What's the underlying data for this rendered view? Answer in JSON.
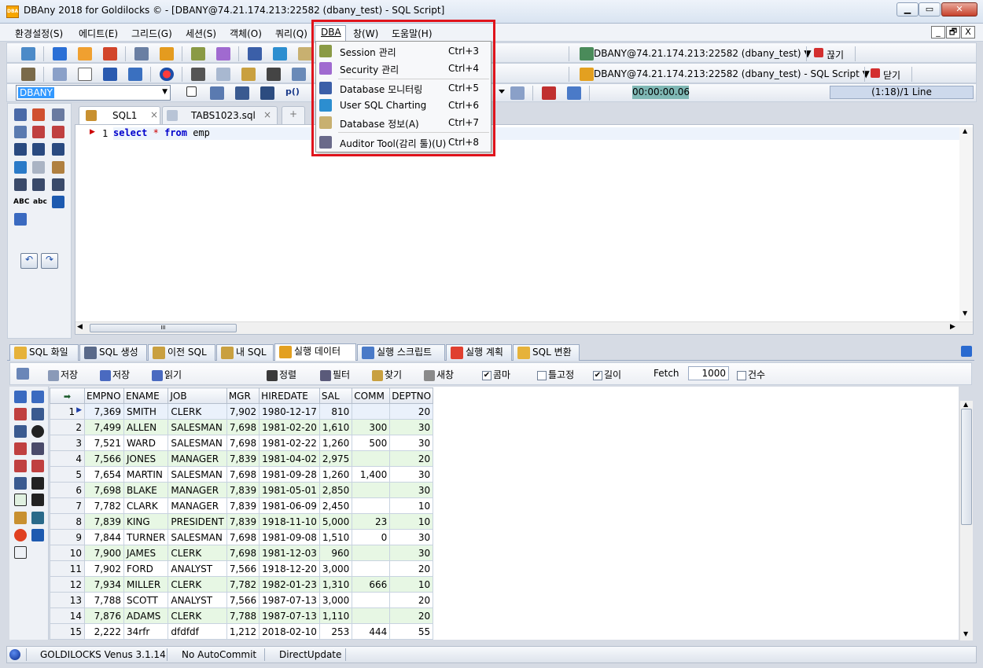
{
  "window": {
    "title": "DBAny 2018 for Goldilocks © - [DBANY@74.21.174.213:22582 (dbany_test) - SQL Script]",
    "logo_text": "DBA",
    "buttons": {
      "minimize": "▭",
      "restore": "▭",
      "close": "✕"
    }
  },
  "menubar": {
    "items": [
      "환경설정(S)",
      "에디트(E)",
      "그리드(G)",
      "세션(S)",
      "객체(O)",
      "쿼리(Q)",
      "DBA",
      "창(W)",
      "도움말(H)"
    ],
    "mdi": [
      "_",
      "🗗",
      "X"
    ]
  },
  "toolbar": {
    "session_label": "DBANY@74.21.174.213:22582 (dbany_test) ▼",
    "disconnect_label": "끊기",
    "script_label": "DBANY@74.21.174.213:22582 (dbany_test) - SQL Script ▼",
    "close_label": "닫기",
    "schema_value": "DBANY",
    "timer": "00:00:00.06",
    "line_info": "(1:18)/1 Line",
    "left_abc_upper": "ABC",
    "left_abc_lower": "abc"
  },
  "editor": {
    "tabs": [
      "SQL1",
      "TABS1023.sql"
    ],
    "line_number": "1",
    "code": {
      "kw1": "select",
      "op": "*",
      "kw2": "from",
      "ident": "emp"
    },
    "hscroll_grip": "III"
  },
  "dba_menu": {
    "items": [
      {
        "label": "Session 관리",
        "shortcut": "Ctrl+3",
        "icon": "session-icon"
      },
      {
        "label": "Security 관리",
        "shortcut": "Ctrl+4",
        "icon": "security-icon"
      },
      {
        "label": "Database 모니터링",
        "shortcut": "Ctrl+5",
        "icon": "monitoring-icon"
      },
      {
        "label": "User SQL Charting",
        "shortcut": "Ctrl+6",
        "icon": "chart-icon"
      },
      {
        "label": "Database 정보(A)",
        "shortcut": "Ctrl+7",
        "icon": "database-info-icon"
      },
      {
        "label": "Auditor Tool(감리 툴)(U)",
        "shortcut": "Ctrl+8",
        "icon": "auditor-icon"
      }
    ]
  },
  "result_tabs": [
    "SQL 화일",
    "SQL 생성",
    "이전 SQL",
    "내 SQL",
    "실행 데이터",
    "실행 스크립트",
    "실행 계획",
    "SQL 변환"
  ],
  "result_toolbar": {
    "save1": "저장",
    "save2": "저장",
    "read": "읽기",
    "sort": "정렬",
    "filter": "필터",
    "find": "찾기",
    "new_window": "새창",
    "comma": "콤마",
    "fixed": "틀고정",
    "length": "길이",
    "fetch_label": "Fetch",
    "fetch_value": "1000",
    "count": "건수"
  },
  "grid": {
    "columns": [
      "EMPNO",
      "ENAME",
      "JOB",
      "MGR",
      "HIREDATE",
      "SAL",
      "COMM",
      "DEPTNO"
    ],
    "rows": [
      [
        "1",
        "7,369",
        "SMITH",
        "CLERK",
        "7,902",
        "1980-12-17",
        "810",
        "",
        "20"
      ],
      [
        "2",
        "7,499",
        "ALLEN",
        "SALESMAN",
        "7,698",
        "1981-02-20",
        "1,610",
        "300",
        "30"
      ],
      [
        "3",
        "7,521",
        "WARD",
        "SALESMAN",
        "7,698",
        "1981-02-22",
        "1,260",
        "500",
        "30"
      ],
      [
        "4",
        "7,566",
        "JONES",
        "MANAGER",
        "7,839",
        "1981-04-02",
        "2,975",
        "",
        "20"
      ],
      [
        "5",
        "7,654",
        "MARTIN",
        "SALESMAN",
        "7,698",
        "1981-09-28",
        "1,260",
        "1,400",
        "30"
      ],
      [
        "6",
        "7,698",
        "BLAKE",
        "MANAGER",
        "7,839",
        "1981-05-01",
        "2,850",
        "",
        "30"
      ],
      [
        "7",
        "7,782",
        "CLARK",
        "MANAGER",
        "7,839",
        "1981-06-09",
        "2,450",
        "",
        "10"
      ],
      [
        "8",
        "7,839",
        "KING",
        "PRESIDENT",
        "7,839",
        "1918-11-10",
        "5,000",
        "23",
        "10"
      ],
      [
        "9",
        "7,844",
        "TURNER",
        "SALESMAN",
        "7,698",
        "1981-09-08",
        "1,510",
        "0",
        "30"
      ],
      [
        "10",
        "7,900",
        "JAMES",
        "CLERK",
        "7,698",
        "1981-12-03",
        "960",
        "",
        "30"
      ],
      [
        "11",
        "7,902",
        "FORD",
        "ANALYST",
        "7,566",
        "1918-12-20",
        "3,000",
        "",
        "20"
      ],
      [
        "12",
        "7,934",
        "MILLER",
        "CLERK",
        "7,782",
        "1982-01-23",
        "1,310",
        "666",
        "10"
      ],
      [
        "13",
        "7,788",
        "SCOTT",
        "ANALYST",
        "7,566",
        "1987-07-13",
        "3,000",
        "",
        "20"
      ],
      [
        "14",
        "7,876",
        "ADAMS",
        "CLERK",
        "7,788",
        "1987-07-13",
        "1,110",
        "",
        "20"
      ],
      [
        "15",
        "2,222",
        "34rfr",
        "dfdfdf",
        "1,212",
        "2018-02-10",
        "253",
        "444",
        "55"
      ]
    ]
  },
  "statusbar": {
    "server": "GOLDILOCKS Venus 3.1.14",
    "autocommit": "No AutoCommit",
    "update_mode": "DirectUpdate"
  },
  "colors": {
    "highlight_border": "#e0141c",
    "row_even": "#e7f7e4",
    "timer_bg": "#7fb8b5"
  }
}
